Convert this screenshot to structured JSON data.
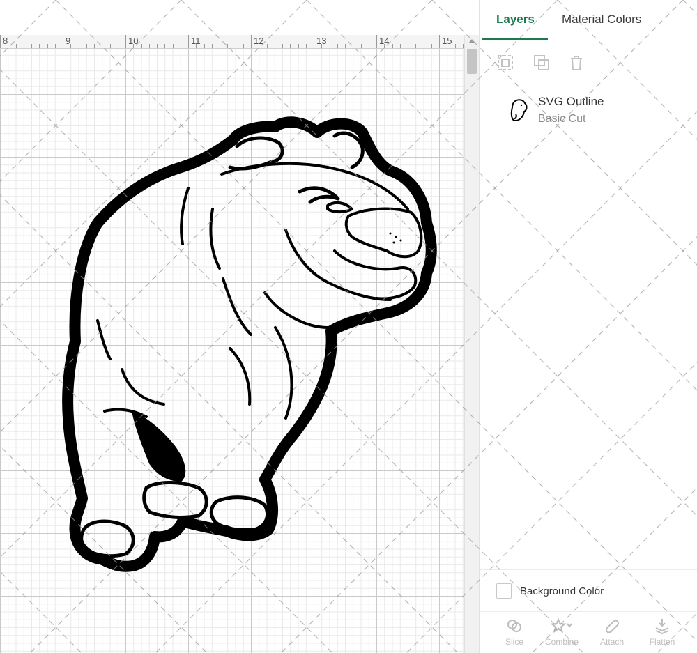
{
  "ruler": {
    "labels": [
      "8",
      "9",
      "10",
      "11",
      "12",
      "13",
      "14",
      "15"
    ]
  },
  "panel": {
    "tabs": [
      {
        "label": "Layers",
        "active": true
      },
      {
        "label": "Material Colors",
        "active": false
      }
    ],
    "toolbar": {
      "icons": [
        "group-icon",
        "duplicate-icon",
        "delete-icon"
      ]
    },
    "layers": [
      {
        "name": "SVG Outline",
        "operation": "Basic Cut",
        "thumbnail": "bulldog-thumbnail"
      }
    ],
    "background": {
      "label": "Background Color",
      "checked": false
    },
    "bottom_actions": [
      {
        "label": "Slice",
        "icon": "slice-icon"
      },
      {
        "label": "Combine",
        "icon": "combine-icon"
      },
      {
        "label": "Attach",
        "icon": "attach-icon"
      },
      {
        "label": "Flatten",
        "icon": "flatten-icon"
      }
    ]
  },
  "colors": {
    "accent": "#1c7a4e",
    "artwork": "#000000",
    "grid_major": "#c9c9c9",
    "grid_minor": "#e9e9e9"
  }
}
